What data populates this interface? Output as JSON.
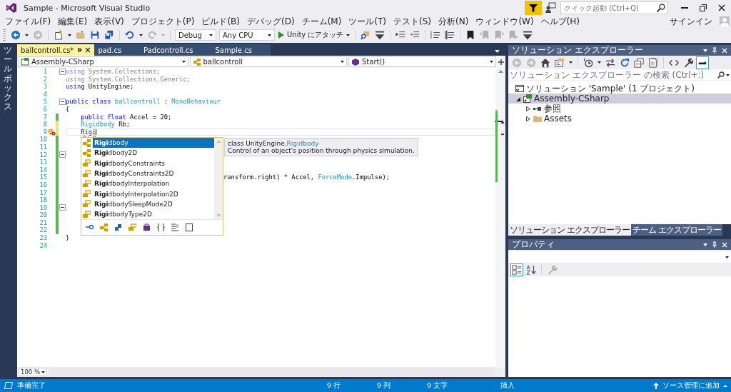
{
  "window": {
    "title": "Sample - Microsoft Visual Studio"
  },
  "quick_launch": {
    "placeholder": "クイック起動 (Ctrl+Q)"
  },
  "menu": [
    "ファイル(F)",
    "編集(E)",
    "表示(V)",
    "プロジェクト(P)",
    "ビルド(B)",
    "デバッグ(D)",
    "チーム(M)",
    "ツール(T)",
    "テスト(S)",
    "分析(N)",
    "ウィンドウ(W)",
    "ヘルプ(H)"
  ],
  "account": {
    "label": "サインイン"
  },
  "toolbar": [
    {
      "kind": "back",
      "disabled": false
    },
    {
      "kind": "dropdown-arrow",
      "disabled": false
    },
    {
      "kind": "forward",
      "disabled": true
    },
    {
      "kind": "separator"
    },
    {
      "kind": "new-project",
      "disabled": false
    },
    {
      "kind": "dropdown-arrow",
      "disabled": false
    },
    {
      "kind": "open",
      "disabled": false
    },
    {
      "kind": "save",
      "disabled": false
    },
    {
      "kind": "save-all",
      "disabled": false
    },
    {
      "kind": "separator"
    },
    {
      "kind": "undo",
      "disabled": false
    },
    {
      "kind": "dropdown-arrow",
      "disabled": false
    },
    {
      "kind": "redo",
      "disabled": true
    },
    {
      "kind": "dropdown-arrow",
      "disabled": true
    },
    {
      "kind": "separator"
    },
    {
      "kind": "dropdown",
      "label": "Debug"
    },
    {
      "kind": "dropdown",
      "label": "Any CPU"
    },
    {
      "kind": "run",
      "label": "Unity にアタッチ"
    },
    {
      "kind": "separator"
    },
    {
      "kind": "find",
      "disabled": false
    },
    {
      "kind": "overflow",
      "disabled": false
    },
    {
      "kind": "separator"
    },
    {
      "kind": "indent",
      "disabled": false
    },
    {
      "kind": "outdent",
      "disabled": false
    },
    {
      "kind": "separator"
    },
    {
      "kind": "comment",
      "disabled": false
    },
    {
      "kind": "uncomment",
      "disabled": false
    },
    {
      "kind": "separator"
    },
    {
      "kind": "bookmark",
      "disabled": false
    },
    {
      "kind": "bookmark-prev",
      "disabled": true
    },
    {
      "kind": "bookmark-next",
      "disabled": true
    },
    {
      "kind": "bookmark-clear",
      "disabled": true
    },
    {
      "kind": "overflow",
      "disabled": false
    }
  ],
  "toolbox_strip": {
    "label": "ツールボックス"
  },
  "editor": {
    "tabs": [
      {
        "label": "ballcontroll.cs*",
        "selected": true
      },
      {
        "label": "pad.cs",
        "selected": false
      },
      {
        "label": "Padcontroll.cs",
        "selected": false
      },
      {
        "label": "Sample.cs",
        "selected": false
      }
    ],
    "navigation": [
      {
        "kind": "project",
        "label": "Assembly-CSharp"
      },
      {
        "kind": "class",
        "label": "ballcontroll"
      },
      {
        "kind": "method",
        "label": "Start()"
      }
    ],
    "lines": [
      {
        "number": "1",
        "fold": true,
        "current": false,
        "caret": false,
        "lightbulb": false,
        "clipped": false,
        "tokens": [
          {
            "kind": "unused-keyword",
            "text": "using"
          },
          {
            "kind": "unused",
            "text": " System.Collections;"
          }
        ]
      },
      {
        "number": "2",
        "fold": false,
        "current": false,
        "caret": false,
        "lightbulb": false,
        "clipped": false,
        "tokens": [
          {
            "kind": "unused-keyword",
            "text": "using"
          },
          {
            "kind": "unused",
            "text": " System.Collections.Generic;"
          }
        ]
      },
      {
        "number": "3",
        "fold": false,
        "current": false,
        "caret": false,
        "lightbulb": false,
        "clipped": false,
        "tokens": [
          {
            "kind": "keyword",
            "text": "using"
          },
          {
            "kind": "plain",
            "text": " UnityEngine;"
          }
        ]
      },
      {
        "number": "4",
        "fold": false,
        "current": false,
        "caret": false,
        "lightbulb": false,
        "clipped": false
      },
      {
        "number": "5",
        "fold": true,
        "current": false,
        "caret": false,
        "lightbulb": false,
        "clipped": false,
        "tokens": [
          {
            "kind": "keyword",
            "text": "public class"
          },
          {
            "kind": "type",
            "text": " ballcontroll"
          },
          {
            "kind": "plain",
            "text": " : "
          },
          {
            "kind": "type",
            "text": "MonoBehaviour"
          }
        ]
      },
      {
        "number": "6",
        "fold": false,
        "current": false,
        "caret": false,
        "lightbulb": false,
        "clipped": false,
        "tokens": [
          {
            "kind": "plain",
            "text": "{"
          }
        ]
      },
      {
        "number": "7",
        "color": "#57b957",
        "fold": false,
        "current": false,
        "caret": false,
        "lightbulb": false,
        "clipped": false,
        "tokens": [
          {
            "kind": "keyword",
            "text": "    public float"
          },
          {
            "kind": "plain",
            "text": " Accel = 20;"
          }
        ]
      },
      {
        "number": "8",
        "color": "#efe27a",
        "fold": false,
        "current": false,
        "caret": false,
        "lightbulb": false,
        "clipped": false,
        "tokens": [
          {
            "kind": "type",
            "text": "    Rigidbody"
          },
          {
            "kind": "plain",
            "text": " Rb;"
          }
        ]
      },
      {
        "number": "9",
        "color": "#efe27a",
        "fold": false,
        "current": true,
        "caret": true,
        "lightbulb": true,
        "clipped": false,
        "tokens": [
          {
            "kind": "error",
            "text": "    Rigi"
          }
        ]
      },
      {
        "number": "10",
        "color": "#57b957",
        "fold": false,
        "current": false,
        "caret": false,
        "lightbulb": false,
        "clipped": false
      },
      {
        "number": "11",
        "color": "#57b957",
        "fold": false,
        "current": false,
        "caret": false,
        "lightbulb": false,
        "clipped": false
      },
      {
        "number": "12",
        "color": "#57b957",
        "fold": true,
        "current": false,
        "caret": false,
        "lightbulb": false,
        "clipped": false
      },
      {
        "number": "13",
        "color": "#57b957",
        "fold": false,
        "current": false,
        "caret": false,
        "lightbulb": false,
        "clipped": false
      },
      {
        "number": "14",
        "color": "#57b957",
        "fold": false,
        "current": false,
        "caret": false,
        "lightbulb": false,
        "clipped": false
      },
      {
        "number": "15",
        "color": "#57b957",
        "fold": false,
        "current": false,
        "caret": false,
        "lightbulb": false,
        "clipped": true,
        "tokens": [
          {
            "kind": "plain",
            "text": "ransform.right) * Accel, "
          },
          {
            "kind": "type",
            "text": "ForceMode"
          },
          {
            "kind": "plain",
            "text": ".Impulse);"
          }
        ]
      },
      {
        "number": "16",
        "color": "#57b957",
        "fold": false,
        "current": false,
        "caret": false,
        "lightbulb": false,
        "clipped": false
      },
      {
        "number": "17",
        "color": "#57b957",
        "fold": false,
        "current": false,
        "caret": false,
        "lightbulb": false,
        "clipped": false
      },
      {
        "number": "18",
        "color": "#57b957",
        "fold": false,
        "current": false,
        "caret": false,
        "lightbulb": false,
        "clipped": false
      },
      {
        "number": "19",
        "color": "#57b957",
        "fold": true,
        "current": false,
        "caret": false,
        "lightbulb": false,
        "clipped": false
      },
      {
        "number": "20",
        "color": "#57b957",
        "fold": false,
        "current": false,
        "caret": false,
        "lightbulb": false,
        "clipped": false
      },
      {
        "number": "21",
        "color": "#57b957",
        "fold": false,
        "current": false,
        "caret": false,
        "lightbulb": false,
        "clipped": false
      },
      {
        "number": "22",
        "color": "#57b957",
        "fold": false,
        "current": false,
        "caret": false,
        "lightbulb": false,
        "clipped": false
      },
      {
        "number": "23",
        "fold": false,
        "current": false,
        "caret": false,
        "lightbulb": false,
        "clipped": false,
        "tokens": [
          {
            "kind": "plain",
            "text": "}"
          }
        ]
      },
      {
        "number": "24",
        "fold": false,
        "current": false,
        "caret": false,
        "lightbulb": false,
        "clipped": false
      }
    ],
    "completion": {
      "items": [
        {
          "label": "**Rigi**dbody",
          "kind": "class",
          "selected": true
        },
        {
          "label": "**Rigi**dbody2D",
          "kind": "class",
          "selected": false
        },
        {
          "label": "**Rigi**dbodyConstraints",
          "kind": "enum",
          "selected": false
        },
        {
          "label": "**Rigi**dbodyConstraints2D",
          "kind": "enum",
          "selected": false
        },
        {
          "label": "**Rigi**dbodyInterpolation",
          "kind": "enum",
          "selected": false
        },
        {
          "label": "**Rigi**dbodyInterpolation2D",
          "kind": "enum",
          "selected": false
        },
        {
          "label": "**Rigi**dbodySleepMode2D",
          "kind": "enum",
          "selected": false
        },
        {
          "label": "**Rigi**dbodyType2D",
          "kind": "enum",
          "selected": false
        }
      ]
    },
    "tooltip": {
      "signature": [
        {
          "kind": "keyword",
          "text": "class"
        },
        {
          "kind": "plain",
          "text": " UnityEngine."
        },
        {
          "kind": "type",
          "text": "Rigidbody"
        }
      ],
      "description": "Control of an object's position through physics simulation."
    },
    "zoom": "100 %"
  },
  "solution_explorer": {
    "title": "ソリューション エクスプローラー",
    "toolbar": [
      {
        "kind": "back",
        "disabled": true,
        "selected": false
      },
      {
        "kind": "forward",
        "disabled": true,
        "selected": false
      },
      {
        "kind": "home",
        "disabled": false,
        "selected": false
      },
      {
        "kind": "switch-views",
        "disabled": false,
        "selected": false
      },
      {
        "kind": "dropdown-arrow",
        "disabled": false
      },
      {
        "kind": "separator"
      },
      {
        "kind": "history",
        "disabled": false,
        "selected": false
      },
      {
        "kind": "dropdown-arrow",
        "disabled": false
      },
      {
        "kind": "sync",
        "disabled": false,
        "selected": false
      },
      {
        "kind": "refresh",
        "disabled": false,
        "selected": false
      },
      {
        "kind": "collapse",
        "disabled": false,
        "selected": false
      },
      {
        "kind": "show-all",
        "disabled": false,
        "selected": false
      },
      {
        "kind": "separator"
      },
      {
        "kind": "code",
        "disabled": false,
        "selected": false
      },
      {
        "kind": "properties",
        "disabled": false,
        "selected": false
      },
      {
        "kind": "preview",
        "disabled": false,
        "selected": true
      }
    ],
    "search": {
      "placeholder": "ソリューション エクスプローラー の検索 (Ctrl+:)"
    },
    "tree": [
      {
        "label": "ソリューション 'Sample' (1 プロジェクト)",
        "kind": "solution",
        "selected": false,
        "children": [
          {
            "label": "Assembly-CSharp",
            "kind": "project",
            "selected": true,
            "expanded": true,
            "children": [
              {
                "label": "参照",
                "kind": "references",
                "selected": false,
                "expanded": false
              },
              {
                "label": "Assets",
                "kind": "folder",
                "selected": false,
                "expanded": false
              }
            ]
          }
        ]
      }
    ],
    "tabs": [
      {
        "label": "ソリューション エクスプローラー",
        "selected": true
      },
      {
        "label": "チーム エクスプローラー",
        "selected": false
      }
    ]
  },
  "properties": {
    "title": "プロパティ",
    "toolbar": [
      {
        "kind": "categorized",
        "disabled": false,
        "selected": true
      },
      {
        "kind": "alphabetical",
        "disabled": false,
        "selected": false
      },
      {
        "kind": "separator"
      },
      {
        "kind": "property-pages",
        "disabled": true,
        "selected": false
      }
    ]
  },
  "status_bar": {
    "message": "準備完了",
    "line": "9 行",
    "column": "9 列",
    "char": "9 文字",
    "mode": "挿入",
    "source_control": "ソース管理に追加"
  }
}
